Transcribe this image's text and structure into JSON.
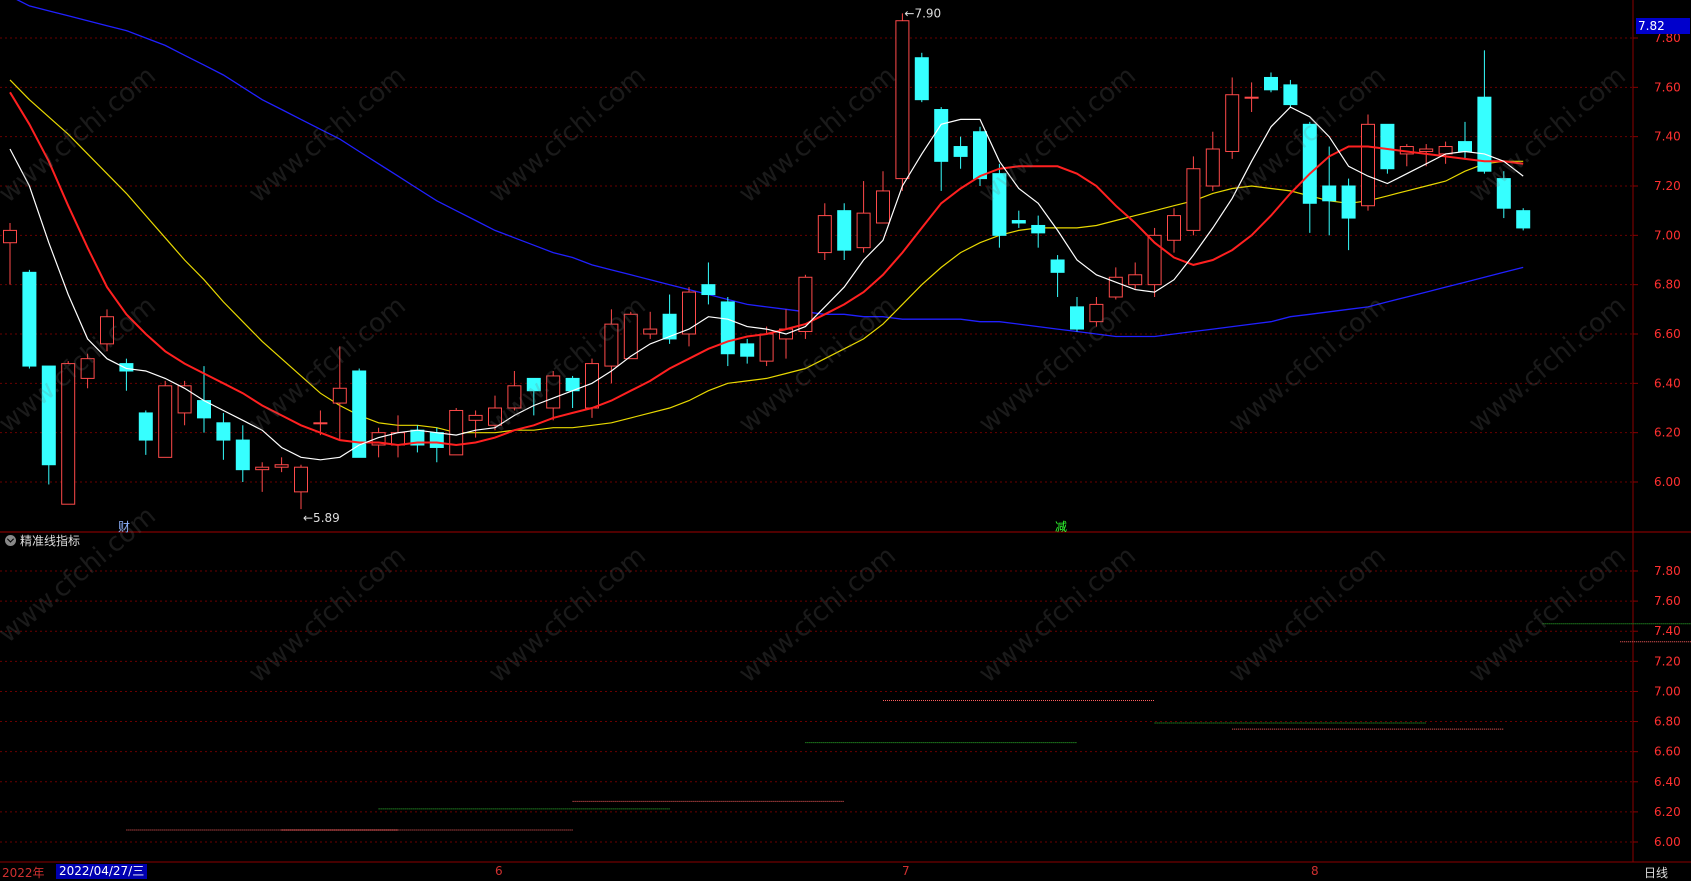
{
  "colors": {
    "up": "#ff4a4a",
    "down": "#36ffff",
    "ma5": "#ffffff",
    "ma10": "#ff2020",
    "ma20": "#e8d800",
    "ma60": "#2020ff",
    "grid": "#6a0000",
    "axis": "#8b0000"
  },
  "chart_data": [
    {
      "type": "candlestick",
      "ylim": [
        5.85,
        7.95
      ],
      "yticks": [
        "6.00",
        "6.20",
        "6.40",
        "6.60",
        "6.80",
        "7.00",
        "7.20",
        "7.40",
        "7.60",
        "7.80"
      ],
      "current_price_tag": "7.82",
      "high_annotation": "7.90",
      "low_annotation": "5.89",
      "candles": [
        {
          "o": 6.97,
          "c": 7.02,
          "h": 7.05,
          "l": 6.8
        },
        {
          "o": 6.85,
          "c": 6.47,
          "h": 6.86,
          "l": 6.46
        },
        {
          "o": 6.47,
          "c": 6.07,
          "h": 6.47,
          "l": 5.99
        },
        {
          "o": 5.91,
          "c": 6.48,
          "h": 6.49,
          "l": 5.91
        },
        {
          "o": 6.42,
          "c": 6.5,
          "h": 6.52,
          "l": 6.38
        },
        {
          "o": 6.56,
          "c": 6.67,
          "h": 6.7,
          "l": 6.53
        },
        {
          "o": 6.48,
          "c": 6.45,
          "h": 6.5,
          "l": 6.37
        },
        {
          "o": 6.28,
          "c": 6.17,
          "h": 6.29,
          "l": 6.11
        },
        {
          "o": 6.1,
          "c": 6.39,
          "h": 6.41,
          "l": 6.1
        },
        {
          "o": 6.28,
          "c": 6.39,
          "h": 6.41,
          "l": 6.23
        },
        {
          "o": 6.33,
          "c": 6.26,
          "h": 6.47,
          "l": 6.2
        },
        {
          "o": 6.24,
          "c": 6.17,
          "h": 6.28,
          "l": 6.09
        },
        {
          "o": 6.17,
          "c": 6.05,
          "h": 6.23,
          "l": 6.0
        },
        {
          "o": 6.05,
          "c": 6.06,
          "h": 6.08,
          "l": 5.96
        },
        {
          "o": 6.06,
          "c": 6.07,
          "h": 6.1,
          "l": 6.04
        },
        {
          "o": 5.96,
          "c": 6.06,
          "h": 6.07,
          "l": 5.89
        },
        {
          "o": 6.24,
          "c": 6.24,
          "h": 6.29,
          "l": 6.19
        },
        {
          "o": 6.32,
          "c": 6.38,
          "h": 6.55,
          "l": 6.17
        },
        {
          "o": 6.45,
          "c": 6.1,
          "h": 6.46,
          "l": 6.1
        },
        {
          "o": 6.15,
          "c": 6.2,
          "h": 6.22,
          "l": 6.1
        },
        {
          "o": 6.15,
          "c": 6.2,
          "h": 6.27,
          "l": 6.1
        },
        {
          "o": 6.21,
          "c": 6.15,
          "h": 6.23,
          "l": 6.12
        },
        {
          "o": 6.2,
          "c": 6.14,
          "h": 6.22,
          "l": 6.08
        },
        {
          "o": 6.11,
          "c": 6.29,
          "h": 6.3,
          "l": 6.11
        },
        {
          "o": 6.25,
          "c": 6.27,
          "h": 6.29,
          "l": 6.18
        },
        {
          "o": 6.23,
          "c": 6.3,
          "h": 6.35,
          "l": 6.21
        },
        {
          "o": 6.3,
          "c": 6.39,
          "h": 6.45,
          "l": 6.29
        },
        {
          "o": 6.42,
          "c": 6.37,
          "h": 6.42,
          "l": 6.27
        },
        {
          "o": 6.3,
          "c": 6.43,
          "h": 6.45,
          "l": 6.25
        },
        {
          "o": 6.42,
          "c": 6.37,
          "h": 6.43,
          "l": 6.3
        },
        {
          "o": 6.3,
          "c": 6.48,
          "h": 6.5,
          "l": 6.26
        },
        {
          "o": 6.47,
          "c": 6.64,
          "h": 6.7,
          "l": 6.4
        },
        {
          "o": 6.5,
          "c": 6.68,
          "h": 6.69,
          "l": 6.5
        },
        {
          "o": 6.6,
          "c": 6.62,
          "h": 6.69,
          "l": 6.58
        },
        {
          "o": 6.68,
          "c": 6.58,
          "h": 6.76,
          "l": 6.56
        },
        {
          "o": 6.6,
          "c": 6.77,
          "h": 6.79,
          "l": 6.55
        },
        {
          "o": 6.8,
          "c": 6.76,
          "h": 6.89,
          "l": 6.72
        },
        {
          "o": 6.73,
          "c": 6.52,
          "h": 6.75,
          "l": 6.47
        },
        {
          "o": 6.56,
          "c": 6.51,
          "h": 6.58,
          "l": 6.48
        },
        {
          "o": 6.49,
          "c": 6.6,
          "h": 6.63,
          "l": 6.47
        },
        {
          "o": 6.58,
          "c": 6.62,
          "h": 6.7,
          "l": 6.5
        },
        {
          "o": 6.61,
          "c": 6.83,
          "h": 6.84,
          "l": 6.58
        },
        {
          "o": 6.93,
          "c": 7.08,
          "h": 7.13,
          "l": 6.9
        },
        {
          "o": 7.1,
          "c": 6.94,
          "h": 7.13,
          "l": 6.9
        },
        {
          "o": 6.95,
          "c": 7.09,
          "h": 7.22,
          "l": 6.93
        },
        {
          "o": 7.05,
          "c": 7.18,
          "h": 7.26,
          "l": 7.05
        },
        {
          "o": 7.23,
          "c": 7.87,
          "h": 7.9,
          "l": 7.18
        },
        {
          "o": 7.72,
          "c": 7.55,
          "h": 7.74,
          "l": 7.54
        },
        {
          "o": 7.51,
          "c": 7.3,
          "h": 7.52,
          "l": 7.18
        },
        {
          "o": 7.36,
          "c": 7.32,
          "h": 7.4,
          "l": 7.27
        },
        {
          "o": 7.42,
          "c": 7.23,
          "h": 7.44,
          "l": 7.2
        },
        {
          "o": 7.25,
          "c": 7.0,
          "h": 7.29,
          "l": 6.95
        },
        {
          "o": 7.06,
          "c": 7.05,
          "h": 7.1,
          "l": 7.03
        },
        {
          "o": 7.04,
          "c": 7.01,
          "h": 7.08,
          "l": 6.95
        },
        {
          "o": 6.9,
          "c": 6.85,
          "h": 6.92,
          "l": 6.75
        },
        {
          "o": 6.71,
          "c": 6.62,
          "h": 6.75,
          "l": 6.61
        },
        {
          "o": 6.65,
          "c": 6.72,
          "h": 6.75,
          "l": 6.63
        },
        {
          "o": 6.75,
          "c": 6.83,
          "h": 6.87,
          "l": 6.74
        },
        {
          "o": 6.8,
          "c": 6.84,
          "h": 6.89,
          "l": 6.78
        },
        {
          "o": 6.8,
          "c": 7.0,
          "h": 7.03,
          "l": 6.75
        },
        {
          "o": 6.98,
          "c": 7.08,
          "h": 7.11,
          "l": 6.93
        },
        {
          "o": 7.02,
          "c": 7.27,
          "h": 7.32,
          "l": 7.0
        },
        {
          "o": 7.2,
          "c": 7.35,
          "h": 7.42,
          "l": 7.18
        },
        {
          "o": 7.34,
          "c": 7.57,
          "h": 7.64,
          "l": 7.31
        },
        {
          "o": 7.56,
          "c": 7.56,
          "h": 7.62,
          "l": 7.5
        },
        {
          "o": 7.64,
          "c": 7.59,
          "h": 7.66,
          "l": 7.58
        },
        {
          "o": 7.61,
          "c": 7.53,
          "h": 7.63,
          "l": 7.52
        },
        {
          "o": 7.45,
          "c": 7.13,
          "h": 7.46,
          "l": 7.01
        },
        {
          "o": 7.2,
          "c": 7.14,
          "h": 7.36,
          "l": 7.0
        },
        {
          "o": 7.2,
          "c": 7.07,
          "h": 7.23,
          "l": 6.94
        },
        {
          "o": 7.12,
          "c": 7.45,
          "h": 7.49,
          "l": 7.1
        },
        {
          "o": 7.45,
          "c": 7.27,
          "h": 7.45,
          "l": 7.25
        },
        {
          "o": 7.33,
          "c": 7.36,
          "h": 7.37,
          "l": 7.28
        },
        {
          "o": 7.34,
          "c": 7.35,
          "h": 7.37,
          "l": 7.28
        },
        {
          "o": 7.33,
          "c": 7.36,
          "h": 7.38,
          "l": 7.29
        },
        {
          "o": 7.38,
          "c": 7.34,
          "h": 7.46,
          "l": 7.31
        },
        {
          "o": 7.56,
          "c": 7.26,
          "h": 7.75,
          "l": 7.25
        },
        {
          "o": 7.23,
          "c": 7.11,
          "h": 7.26,
          "l": 7.07
        },
        {
          "o": 7.1,
          "c": 7.03,
          "h": 7.11,
          "l": 7.02
        }
      ],
      "ma5": [
        7.35,
        7.2,
        6.97,
        6.76,
        6.58,
        6.5,
        6.46,
        6.45,
        6.42,
        6.38,
        6.33,
        6.29,
        6.25,
        6.21,
        6.14,
        6.1,
        6.09,
        6.1,
        6.15,
        6.18,
        6.2,
        6.21,
        6.2,
        6.19,
        6.21,
        6.22,
        6.27,
        6.31,
        6.34,
        6.37,
        6.4,
        6.45,
        6.51,
        6.56,
        6.59,
        6.62,
        6.67,
        6.66,
        6.63,
        6.62,
        6.6,
        6.63,
        6.71,
        6.79,
        6.9,
        6.98,
        7.2,
        7.33,
        7.45,
        7.47,
        7.47,
        7.3,
        7.19,
        7.13,
        7.02,
        6.9,
        6.84,
        6.81,
        6.78,
        6.77,
        6.82,
        6.92,
        7.03,
        7.15,
        7.3,
        7.44,
        7.52,
        7.48,
        7.4,
        7.28,
        7.24,
        7.21,
        7.25,
        7.29,
        7.33,
        7.34,
        7.33,
        7.3,
        7.24
      ],
      "ma10": [
        7.58,
        7.45,
        7.3,
        7.12,
        6.95,
        6.79,
        6.68,
        6.6,
        6.53,
        6.48,
        6.44,
        6.4,
        6.36,
        6.31,
        6.27,
        6.23,
        6.2,
        6.17,
        6.16,
        6.16,
        6.15,
        6.16,
        6.16,
        6.15,
        6.16,
        6.18,
        6.21,
        6.23,
        6.26,
        6.28,
        6.3,
        6.33,
        6.37,
        6.41,
        6.46,
        6.5,
        6.54,
        6.57,
        6.59,
        6.6,
        6.62,
        6.64,
        6.68,
        6.72,
        6.77,
        6.84,
        6.93,
        7.03,
        7.13,
        7.19,
        7.24,
        7.27,
        7.28,
        7.28,
        7.28,
        7.25,
        7.2,
        7.12,
        7.05,
        6.97,
        6.91,
        6.88,
        6.9,
        6.94,
        7.0,
        7.08,
        7.17,
        7.25,
        7.32,
        7.36,
        7.36,
        7.35,
        7.34,
        7.33,
        7.32,
        7.31,
        7.3,
        7.3,
        7.29
      ],
      "ma20": [
        7.63,
        7.55,
        7.48,
        7.41,
        7.33,
        7.25,
        7.17,
        7.08,
        6.99,
        6.9,
        6.82,
        6.73,
        6.65,
        6.57,
        6.5,
        6.43,
        6.36,
        6.31,
        6.27,
        6.24,
        6.23,
        6.23,
        6.22,
        6.2,
        6.2,
        6.2,
        6.21,
        6.21,
        6.22,
        6.22,
        6.23,
        6.24,
        6.26,
        6.28,
        6.3,
        6.33,
        6.37,
        6.4,
        6.41,
        6.42,
        6.44,
        6.46,
        6.5,
        6.54,
        6.58,
        6.64,
        6.72,
        6.8,
        6.87,
        6.93,
        6.97,
        7.0,
        7.02,
        7.03,
        7.03,
        7.03,
        7.04,
        7.06,
        7.08,
        7.1,
        7.12,
        7.14,
        7.17,
        7.19,
        7.2,
        7.19,
        7.18,
        7.16,
        7.14,
        7.13,
        7.14,
        7.16,
        7.18,
        7.2,
        7.22,
        7.26,
        7.29,
        7.3,
        7.3
      ],
      "ma60": [
        7.97,
        7.93,
        7.91,
        7.89,
        7.87,
        7.85,
        7.83,
        7.8,
        7.77,
        7.73,
        7.69,
        7.65,
        7.6,
        7.55,
        7.51,
        7.47,
        7.43,
        7.39,
        7.34,
        7.29,
        7.24,
        7.19,
        7.14,
        7.1,
        7.06,
        7.02,
        6.99,
        6.96,
        6.93,
        6.91,
        6.88,
        6.86,
        6.84,
        6.82,
        6.8,
        6.78,
        6.76,
        6.74,
        6.72,
        6.71,
        6.7,
        6.69,
        6.68,
        6.68,
        6.67,
        6.67,
        6.66,
        6.66,
        6.66,
        6.66,
        6.65,
        6.65,
        6.64,
        6.63,
        6.62,
        6.61,
        6.6,
        6.59,
        6.59,
        6.59,
        6.6,
        6.61,
        6.62,
        6.63,
        6.64,
        6.65,
        6.67,
        6.68,
        6.69,
        6.7,
        6.71,
        6.73,
        6.75,
        6.77,
        6.79,
        6.81,
        6.83,
        6.85,
        6.87
      ]
    },
    {
      "type": "line",
      "title": "精准线指标",
      "ylim": [
        5.9,
        7.95
      ],
      "yticks": [
        "6.00",
        "6.20",
        "6.40",
        "6.60",
        "6.80",
        "7.00",
        "7.20",
        "7.40",
        "7.60",
        "7.80"
      ],
      "segments": [
        {
          "color": "red",
          "y": 6.08,
          "x_from": 6,
          "x_to": 20
        },
        {
          "color": "red",
          "y": 6.08,
          "x_from": 14,
          "x_to": 29
        },
        {
          "color": "green",
          "y": 6.22,
          "x_from": 19,
          "x_to": 34
        },
        {
          "color": "red",
          "y": 6.27,
          "x_from": 29,
          "x_to": 43
        },
        {
          "color": "green",
          "y": 6.66,
          "x_from": 41,
          "x_to": 55
        },
        {
          "color": "red",
          "y": 6.94,
          "x_from": 45,
          "x_to": 59
        },
        {
          "color": "green",
          "y": 6.79,
          "x_from": 59,
          "x_to": 73
        },
        {
          "color": "red",
          "y": 6.75,
          "x_from": 63,
          "x_to": 77
        },
        {
          "color": "green",
          "y": 7.45,
          "x_from": 79,
          "x_to": 93
        },
        {
          "color": "red",
          "y": 7.33,
          "x_from": 83,
          "x_to": 97
        }
      ]
    }
  ],
  "markers": {
    "cai": "财",
    "jian": "减"
  },
  "indicator_title": "精准线指标",
  "bottom": {
    "year": "2022年",
    "date": "2022/04/27/三",
    "months": [
      "6",
      "7",
      "8"
    ],
    "period": "日线"
  },
  "watermark": "www.cfchi.com"
}
